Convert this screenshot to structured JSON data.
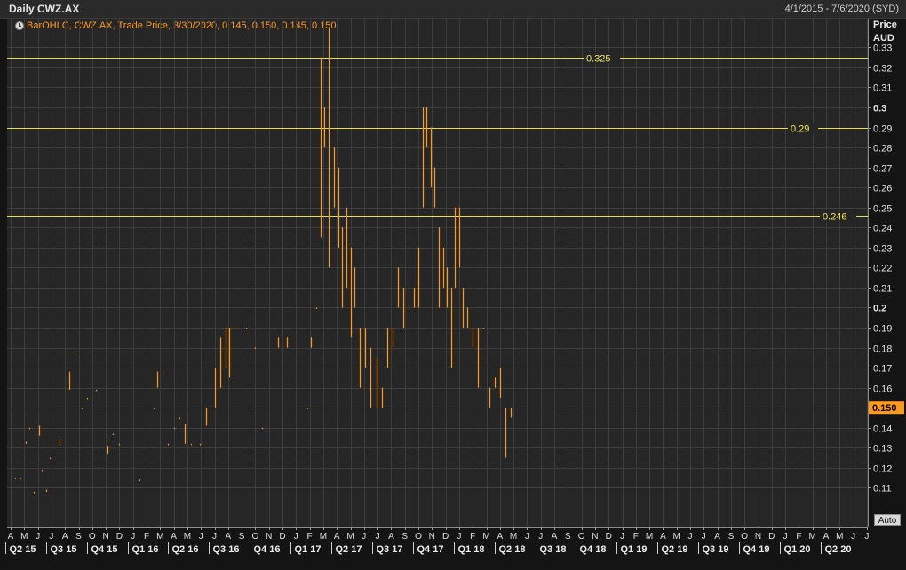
{
  "header": {
    "title": "Daily CWZ.AX",
    "date_range": "4/1/2015 - 7/6/2020 (SYD)"
  },
  "legend": {
    "text": "BarOHLC, CWZ.AX, Trade Price, 3/30/2020, 0.145, 0.150, 0.145, 0.150"
  },
  "yaxis": {
    "title": "Price",
    "unit": "AUD",
    "ticks": [
      "0.11",
      "0.12",
      "0.13",
      "0.14",
      "0.15",
      "0.16",
      "0.17",
      "0.18",
      "0.19",
      "0.2",
      "0.21",
      "0.22",
      "0.23",
      "0.24",
      "0.25",
      "0.26",
      "0.27",
      "0.28",
      "0.29",
      "0.3",
      "0.31",
      "0.32",
      "0.33"
    ],
    "bold_ticks": [
      "0.2",
      "0.3"
    ],
    "last_price_label": "0.150",
    "auto_label": "Auto"
  },
  "xaxis": {
    "months": [
      "A",
      "M",
      "J",
      "J",
      "A",
      "S",
      "O",
      "N",
      "D",
      "J",
      "F",
      "M",
      "A",
      "M",
      "J",
      "J",
      "A",
      "S",
      "O",
      "N",
      "D",
      "J",
      "F",
      "M",
      "A",
      "M",
      "J",
      "J",
      "A",
      "S",
      "O",
      "N",
      "D",
      "J",
      "F",
      "M",
      "A",
      "M",
      "J",
      "J",
      "A",
      "S",
      "O",
      "N",
      "D",
      "J",
      "F",
      "M",
      "A",
      "M",
      "J",
      "J",
      "A",
      "S",
      "O",
      "N",
      "D",
      "J",
      "F",
      "M",
      "A",
      "M",
      "J",
      "J"
    ],
    "quarters": [
      "Q2 15",
      "Q3 15",
      "Q4 15",
      "Q1 16",
      "Q2 16",
      "Q3 16",
      "Q4 16",
      "Q1 17",
      "Q2 17",
      "Q3 17",
      "Q4 17",
      "Q1 18",
      "Q2 18",
      "Q3 18",
      "Q4 18",
      "Q1 19",
      "Q2 19",
      "Q3 19",
      "Q4 19",
      "Q1 20",
      "Q2 20"
    ]
  },
  "colors": {
    "background": "#262626",
    "grid": "#3d3d3d",
    "bars": "#ff9a1f",
    "hlines": "#e8e040",
    "last_price_bg": "#ff9a1f"
  },
  "chart_data": {
    "type": "bar-ohlc",
    "title": "Daily CWZ.AX",
    "ylabel": "Price AUD",
    "ylim": [
      0.105,
      0.343
    ],
    "date_range": [
      "4/1/2015",
      "7/6/2020"
    ],
    "grid": true,
    "horizontal_lines": [
      {
        "value": 0.325,
        "label": "0.325"
      },
      {
        "value": 0.29,
        "label": "0.29"
      },
      {
        "value": 0.246,
        "label": "0.246"
      }
    ],
    "last_close": 0.15,
    "bars_approx": [
      {
        "m": 0.3,
        "lo": 0.115,
        "hi": 0.115
      },
      {
        "m": 0.7,
        "lo": 0.115,
        "hi": 0.115
      },
      {
        "m": 1.1,
        "lo": 0.132,
        "hi": 0.133
      },
      {
        "m": 1.4,
        "lo": 0.14,
        "hi": 0.14
      },
      {
        "m": 1.7,
        "lo": 0.108,
        "hi": 0.108
      },
      {
        "m": 2.1,
        "lo": 0.136,
        "hi": 0.141
      },
      {
        "m": 2.3,
        "lo": 0.118,
        "hi": 0.119
      },
      {
        "m": 2.6,
        "lo": 0.108,
        "hi": 0.109
      },
      {
        "m": 2.9,
        "lo": 0.125,
        "hi": 0.125
      },
      {
        "m": 3.6,
        "lo": 0.131,
        "hi": 0.134
      },
      {
        "m": 4.3,
        "lo": 0.159,
        "hi": 0.168
      },
      {
        "m": 4.7,
        "lo": 0.177,
        "hi": 0.177
      },
      {
        "m": 5.2,
        "lo": 0.15,
        "hi": 0.15
      },
      {
        "m": 5.6,
        "lo": 0.155,
        "hi": 0.155
      },
      {
        "m": 6.3,
        "lo": 0.159,
        "hi": 0.159
      },
      {
        "m": 7.1,
        "lo": 0.127,
        "hi": 0.131
      },
      {
        "m": 7.5,
        "lo": 0.137,
        "hi": 0.137
      },
      {
        "m": 8.0,
        "lo": 0.132,
        "hi": 0.132
      },
      {
        "m": 9.5,
        "lo": 0.114,
        "hi": 0.114
      },
      {
        "m": 10.5,
        "lo": 0.15,
        "hi": 0.15
      },
      {
        "m": 10.8,
        "lo": 0.16,
        "hi": 0.168
      },
      {
        "m": 11.2,
        "lo": 0.167,
        "hi": 0.168
      },
      {
        "m": 11.6,
        "lo": 0.132,
        "hi": 0.132
      },
      {
        "m": 12.0,
        "lo": 0.14,
        "hi": 0.14
      },
      {
        "m": 12.4,
        "lo": 0.145,
        "hi": 0.145
      },
      {
        "m": 12.8,
        "lo": 0.132,
        "hi": 0.142
      },
      {
        "m": 13.3,
        "lo": 0.132,
        "hi": 0.132
      },
      {
        "m": 13.9,
        "lo": 0.132,
        "hi": 0.132
      },
      {
        "m": 14.4,
        "lo": 0.141,
        "hi": 0.15
      },
      {
        "m": 15.0,
        "lo": 0.15,
        "hi": 0.17
      },
      {
        "m": 15.4,
        "lo": 0.16,
        "hi": 0.185
      },
      {
        "m": 15.8,
        "lo": 0.17,
        "hi": 0.19
      },
      {
        "m": 16.1,
        "lo": 0.165,
        "hi": 0.19
      },
      {
        "m": 16.4,
        "lo": 0.19,
        "hi": 0.19
      },
      {
        "m": 17.3,
        "lo": 0.19,
        "hi": 0.19
      },
      {
        "m": 18.0,
        "lo": 0.18,
        "hi": 0.18
      },
      {
        "m": 18.5,
        "lo": 0.14,
        "hi": 0.14
      },
      {
        "m": 19.7,
        "lo": 0.18,
        "hi": 0.185
      },
      {
        "m": 20.3,
        "lo": 0.18,
        "hi": 0.185
      },
      {
        "m": 21.8,
        "lo": 0.15,
        "hi": 0.15
      },
      {
        "m": 22.1,
        "lo": 0.18,
        "hi": 0.185
      },
      {
        "m": 22.5,
        "lo": 0.2,
        "hi": 0.2
      },
      {
        "m": 22.8,
        "lo": 0.235,
        "hi": 0.325
      },
      {
        "m": 23.1,
        "lo": 0.28,
        "hi": 0.3
      },
      {
        "m": 23.4,
        "lo": 0.22,
        "hi": 0.34
      },
      {
        "m": 23.8,
        "lo": 0.25,
        "hi": 0.28
      },
      {
        "m": 24.1,
        "lo": 0.23,
        "hi": 0.27
      },
      {
        "m": 24.4,
        "lo": 0.2,
        "hi": 0.24
      },
      {
        "m": 24.7,
        "lo": 0.21,
        "hi": 0.25
      },
      {
        "m": 25.0,
        "lo": 0.185,
        "hi": 0.23
      },
      {
        "m": 25.3,
        "lo": 0.2,
        "hi": 0.22
      },
      {
        "m": 25.7,
        "lo": 0.16,
        "hi": 0.19
      },
      {
        "m": 26.1,
        "lo": 0.17,
        "hi": 0.19
      },
      {
        "m": 26.5,
        "lo": 0.15,
        "hi": 0.18
      },
      {
        "m": 26.9,
        "lo": 0.15,
        "hi": 0.175
      },
      {
        "m": 27.3,
        "lo": 0.15,
        "hi": 0.16
      },
      {
        "m": 27.7,
        "lo": 0.17,
        "hi": 0.19
      },
      {
        "m": 28.1,
        "lo": 0.18,
        "hi": 0.19
      },
      {
        "m": 28.5,
        "lo": 0.2,
        "hi": 0.22
      },
      {
        "m": 28.9,
        "lo": 0.19,
        "hi": 0.21
      },
      {
        "m": 29.3,
        "lo": 0.2,
        "hi": 0.2
      },
      {
        "m": 29.7,
        "lo": 0.2,
        "hi": 0.21
      },
      {
        "m": 30.0,
        "lo": 0.2,
        "hi": 0.23
      },
      {
        "m": 30.3,
        "lo": 0.25,
        "hi": 0.3
      },
      {
        "m": 30.6,
        "lo": 0.28,
        "hi": 0.3
      },
      {
        "m": 30.9,
        "lo": 0.26,
        "hi": 0.29
      },
      {
        "m": 31.2,
        "lo": 0.25,
        "hi": 0.27
      },
      {
        "m": 31.5,
        "lo": 0.2,
        "hi": 0.24
      },
      {
        "m": 31.8,
        "lo": 0.21,
        "hi": 0.23
      },
      {
        "m": 32.1,
        "lo": 0.2,
        "hi": 0.22
      },
      {
        "m": 32.4,
        "lo": 0.17,
        "hi": 0.21
      },
      {
        "m": 32.7,
        "lo": 0.21,
        "hi": 0.25
      },
      {
        "m": 33.0,
        "lo": 0.22,
        "hi": 0.25
      },
      {
        "m": 33.3,
        "lo": 0.19,
        "hi": 0.21
      },
      {
        "m": 33.6,
        "lo": 0.19,
        "hi": 0.2
      },
      {
        "m": 34.0,
        "lo": 0.18,
        "hi": 0.19
      },
      {
        "m": 34.4,
        "lo": 0.16,
        "hi": 0.19
      },
      {
        "m": 34.8,
        "lo": 0.19,
        "hi": 0.19
      },
      {
        "m": 35.2,
        "lo": 0.15,
        "hi": 0.16
      },
      {
        "m": 35.6,
        "lo": 0.16,
        "hi": 0.165
      },
      {
        "m": 36.0,
        "lo": 0.155,
        "hi": 0.17
      },
      {
        "m": 36.4,
        "lo": 0.125,
        "hi": 0.15
      },
      {
        "m": 36.8,
        "lo": 0.145,
        "hi": 0.15
      }
    ]
  }
}
